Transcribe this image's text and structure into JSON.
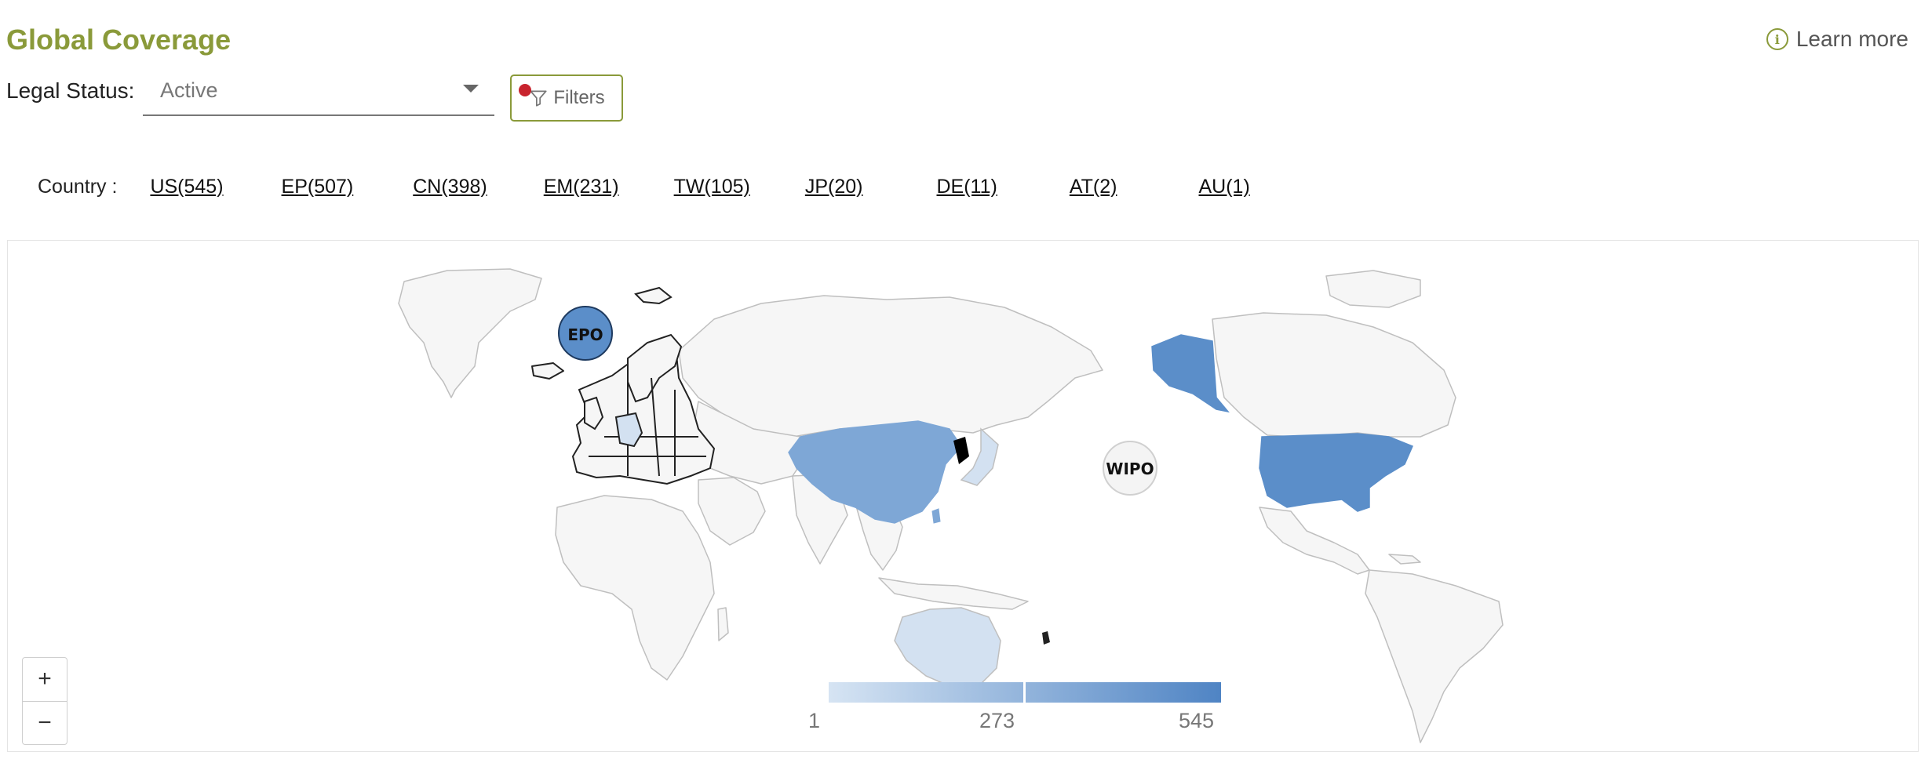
{
  "header": {
    "title": "Global Coverage",
    "learn_more": "Learn more",
    "info_glyph": "i"
  },
  "filters": {
    "legal_status_label": "Legal Status:",
    "legal_status_value": "Active",
    "filters_button": "Filters"
  },
  "countries": {
    "label": "Country :",
    "items": [
      {
        "label": "US(545)"
      },
      {
        "label": "EP(507)"
      },
      {
        "label": "CN(398)"
      },
      {
        "label": "EM(231)"
      },
      {
        "label": "TW(105)"
      },
      {
        "label": "JP(20)"
      },
      {
        "label": "DE(11)"
      },
      {
        "label": "AT(2)"
      },
      {
        "label": "AU(1)"
      }
    ]
  },
  "map": {
    "markers": {
      "epo": "EPO",
      "wipo": "WIPO"
    },
    "zoom_in": "+",
    "zoom_out": "−",
    "legend": {
      "min": "1",
      "mid": "273",
      "max": "545"
    },
    "colors": {
      "high": "#5b8ec9",
      "mid": "#7ea7d6",
      "low": "#d3e1f1",
      "land": "#f6f6f6",
      "border": "#bfbfbf"
    }
  }
}
